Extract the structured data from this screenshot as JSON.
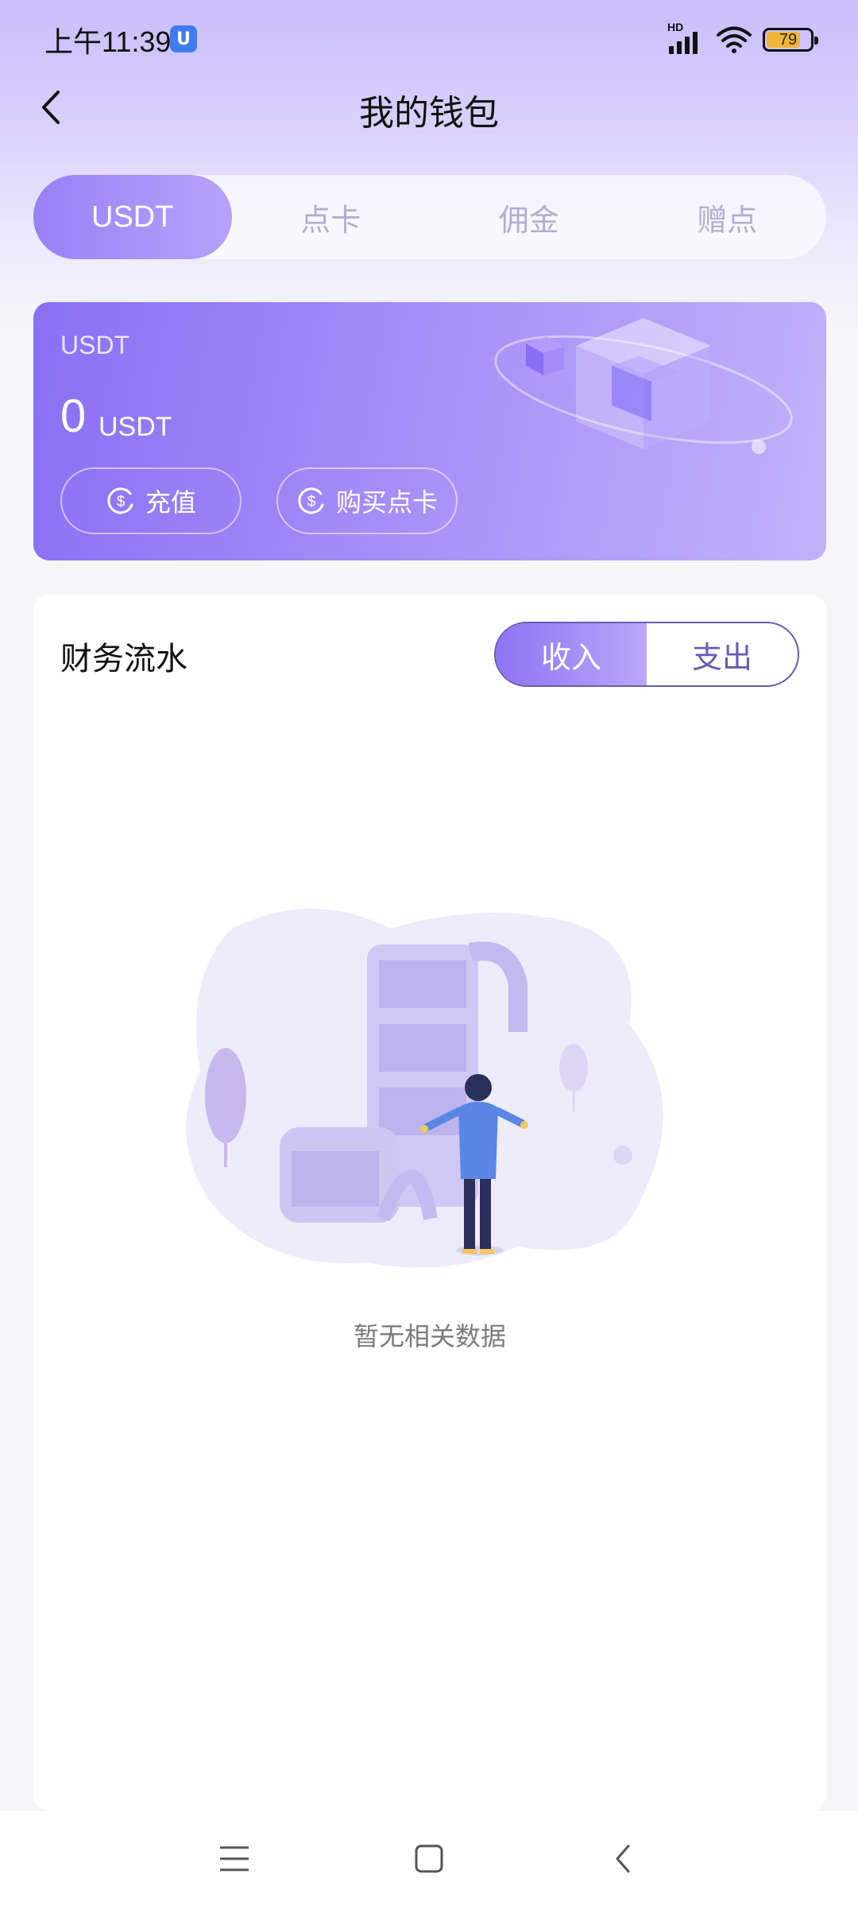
{
  "status_bar": {
    "time": "上午11:39",
    "app_badge": "U",
    "network_type": "HD",
    "battery_level": "79",
    "battery_fraction": 0.79
  },
  "header": {
    "title": "我的钱包",
    "back_icon": "chevron-left-icon"
  },
  "tabs": [
    {
      "label": "USDT",
      "active": true
    },
    {
      "label": "点卡",
      "active": false
    },
    {
      "label": "佣金",
      "active": false
    },
    {
      "label": "赠点",
      "active": false
    }
  ],
  "balance_card": {
    "label": "USDT",
    "amount": "0",
    "unit": "USDT",
    "buttons": {
      "recharge": "充值",
      "buy_card": "购买点卡"
    },
    "button_icon": "dollar-coin-icon"
  },
  "finance": {
    "title": "财务流水",
    "segments": [
      {
        "label": "收入",
        "active": true
      },
      {
        "label": "支出",
        "active": false
      }
    ],
    "empty_text": "暂无相关数据"
  },
  "nav_bar": {
    "icons": [
      "menu-icon",
      "home-icon",
      "back-icon"
    ]
  },
  "colors": {
    "accent": "#9a80f6",
    "segment_border": "#6b5bb5",
    "card_start": "#8a6ff4",
    "card_end": "#c2b2fb",
    "battery": "#f2b53a"
  }
}
